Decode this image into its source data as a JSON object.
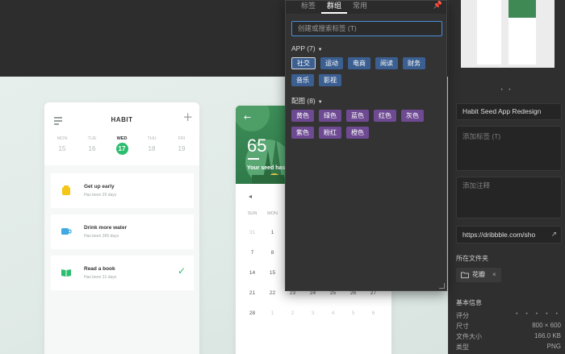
{
  "habit": {
    "title": "HABIT",
    "days": [
      {
        "name": "MON",
        "num": "15"
      },
      {
        "name": "TUE",
        "num": "16"
      },
      {
        "name": "WED",
        "num": "17"
      },
      {
        "name": "THU",
        "num": "18"
      },
      {
        "name": "FRI",
        "num": "19"
      }
    ],
    "cards": [
      {
        "title": "Get up early",
        "sub": "Has been 20 days",
        "color": "#f5c518"
      },
      {
        "title": "Drink more water",
        "sub": "Has been 365 days",
        "color": "#3fa9e0"
      },
      {
        "title": "Read a book",
        "sub": "Has been 31 days",
        "color": "#2dbd6e"
      }
    ]
  },
  "seed": {
    "count": "65",
    "text": "Your seed has",
    "weekdays": [
      "SUN",
      "MON",
      "",
      "",
      "",
      "",
      ""
    ],
    "weeks": [
      [
        "31",
        "1",
        "",
        "",
        "",
        "",
        ""
      ],
      [
        "7",
        "8",
        "",
        "",
        "",
        "",
        ""
      ],
      [
        "14",
        "15",
        "",
        "",
        "",
        "",
        ""
      ],
      [
        "21",
        "22",
        "23",
        "24",
        "25",
        "26",
        "27"
      ],
      [
        "28",
        "1",
        "2",
        "3",
        "4",
        "5",
        "6"
      ]
    ]
  },
  "popup": {
    "tabs": [
      "标签",
      "群组",
      "常用"
    ],
    "search_placeholder": "创建或搜索标签 (T)",
    "group1": {
      "label": "APP (7)",
      "tags": [
        "社交",
        "运动",
        "电商",
        "阅读",
        "财务",
        "音乐",
        "影视"
      ]
    },
    "group2": {
      "label": "配图 (8)",
      "tags": [
        "黄色",
        "绿色",
        "蓝色",
        "红色",
        "灰色",
        "紫色",
        "粉红",
        "橙色"
      ]
    }
  },
  "right": {
    "pager": "• •",
    "name": "Habit Seed App Redesign",
    "tags_placeholder": "添加标签 (T)",
    "notes_placeholder": "添加注释",
    "url": "https://dribbble.com/sho",
    "folder_label": "所在文件夹",
    "folder": "花瓣",
    "info_label": "基本信息",
    "info": [
      {
        "k": "评分",
        "v": "• • • • •"
      },
      {
        "k": "尺寸",
        "v": "800 × 600"
      },
      {
        "k": "文件大小",
        "v": "166.0 KB"
      },
      {
        "k": "类型",
        "v": "PNG"
      }
    ]
  }
}
